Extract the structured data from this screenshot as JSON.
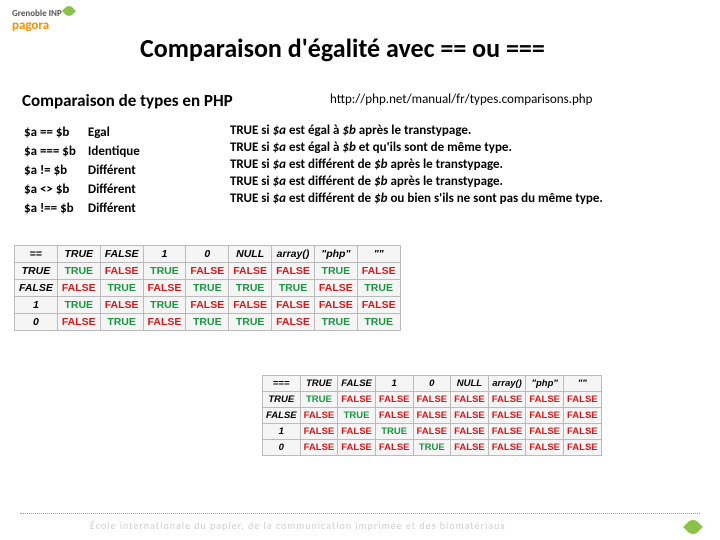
{
  "logo": {
    "line1": "Grenoble",
    "line2": "INP",
    "brand": "pagora"
  },
  "title": "Comparaison d'égalité avec == ou ===",
  "subtitle": "Comparaison de types en PHP",
  "url": "http://php.net/manual/fr/types.comparisons.php",
  "operators": [
    {
      "expr": "$a == $b",
      "name": "Egal",
      "desc": "TRUE si $a est égal à $b après le transtypage."
    },
    {
      "expr": "$a === $b",
      "name": "Identique",
      "desc": "TRUE si $a est égal à $b et qu'ils sont de même type."
    },
    {
      "expr": "$a != $b",
      "name": "Différent",
      "desc": "TRUE si $a est différent de $b après le transtypage."
    },
    {
      "expr": "$a <> $b",
      "name": "Différent",
      "desc": "TRUE si $a est différent de $b après le transtypage."
    },
    {
      "expr": "$a !== $b",
      "name": "Différent",
      "desc": "TRUE si $a est différent de $b ou bien s'ils ne sont pas du même type."
    }
  ],
  "chart_data": [
    {
      "type": "table",
      "title": "==",
      "columns": [
        "TRUE",
        "FALSE",
        "1",
        "0",
        "NULL",
        "array()",
        "\"php\"",
        "\"\""
      ],
      "rows": [
        "TRUE",
        "FALSE",
        "1",
        "0"
      ],
      "cells": [
        [
          "TRUE",
          "FALSE",
          "TRUE",
          "FALSE",
          "FALSE",
          "FALSE",
          "TRUE",
          "FALSE"
        ],
        [
          "FALSE",
          "TRUE",
          "FALSE",
          "TRUE",
          "TRUE",
          "TRUE",
          "FALSE",
          "TRUE"
        ],
        [
          "TRUE",
          "FALSE",
          "TRUE",
          "FALSE",
          "FALSE",
          "FALSE",
          "FALSE",
          "FALSE"
        ],
        [
          "FALSE",
          "TRUE",
          "FALSE",
          "TRUE",
          "TRUE",
          "FALSE",
          "TRUE",
          "TRUE"
        ]
      ]
    },
    {
      "type": "table",
      "title": "===",
      "columns": [
        "TRUE",
        "FALSE",
        "1",
        "0",
        "NULL",
        "array()",
        "\"php\"",
        "\"\""
      ],
      "rows": [
        "TRUE",
        "FALSE",
        "1",
        "0"
      ],
      "cells": [
        [
          "TRUE",
          "FALSE",
          "FALSE",
          "FALSE",
          "FALSE",
          "FALSE",
          "FALSE",
          "FALSE"
        ],
        [
          "FALSE",
          "TRUE",
          "FALSE",
          "FALSE",
          "FALSE",
          "FALSE",
          "FALSE",
          "FALSE"
        ],
        [
          "FALSE",
          "FALSE",
          "TRUE",
          "FALSE",
          "FALSE",
          "FALSE",
          "FALSE",
          "FALSE"
        ],
        [
          "FALSE",
          "FALSE",
          "FALSE",
          "TRUE",
          "FALSE",
          "FALSE",
          "FALSE",
          "FALSE"
        ]
      ]
    }
  ],
  "footer": "École internationale du papier, de la communication imprimée et des biomatériaux"
}
